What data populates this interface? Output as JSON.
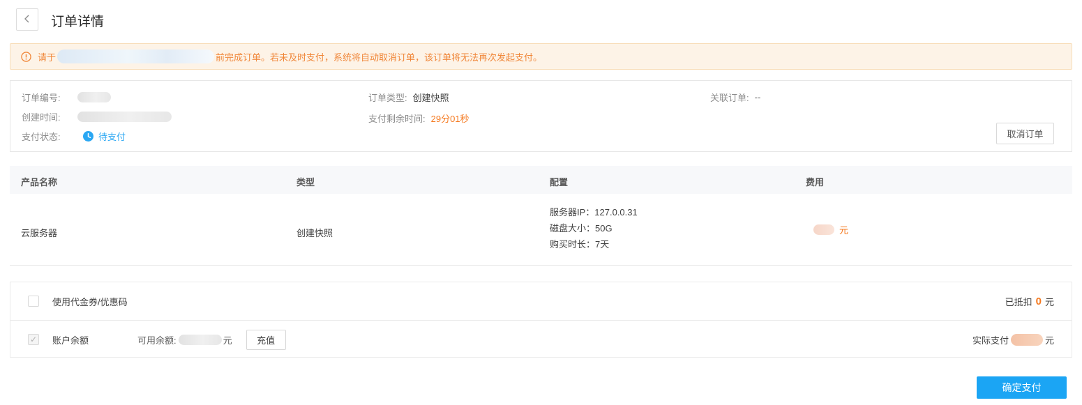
{
  "page": {
    "title": "订单详情"
  },
  "icons": {
    "back": "chevron-left",
    "alert": "warning-circle",
    "pay_status": "clock",
    "checked_mark": "✓"
  },
  "alert": {
    "prefix": "请于",
    "suffix": "前完成订单。若未及时支付，系统将自动取消订单，该订单将无法再次发起支付。"
  },
  "order_info": {
    "order_no_label": "订单编号:",
    "create_time_label": "创建时间:",
    "pay_status_label": "支付状态:",
    "pay_status_value": "待支付",
    "order_type_label": "订单类型:",
    "order_type_value": "创建快照",
    "remain_time_label": "支付剩余时间:",
    "remain_time_value": "29分01秒",
    "related_order_label": "关联订单:",
    "related_order_value": "--",
    "cancel_button": "取消订单"
  },
  "product_table": {
    "headers": [
      "产品名称",
      "类型",
      "配置",
      "费用"
    ],
    "rows": [
      {
        "name": "云服务器",
        "type": "创建快照",
        "config": [
          "服务器IP：127.0.0.31",
          "磁盘大小：50G",
          "购买时长：7天"
        ],
        "fee_unit": "元"
      }
    ]
  },
  "payment": {
    "coupon_label": "使用代金券/优惠码",
    "deducted_label": "已抵扣",
    "deducted_value": "0",
    "unit": "元",
    "balance_label": "账户余额",
    "available_label": "可用余额:",
    "recharge_button": "充值",
    "actual_label": "实际支付"
  },
  "footer": {
    "confirm_button": "确定支付"
  },
  "colors": {
    "accent_orange": "#f5791f",
    "accent_blue": "#1ba5f4",
    "status_blue": "#2aa7f3",
    "alert_bg": "#fdf3e7",
    "alert_border": "#f8ddb9",
    "table_header_bg": "#f7f8fa"
  }
}
